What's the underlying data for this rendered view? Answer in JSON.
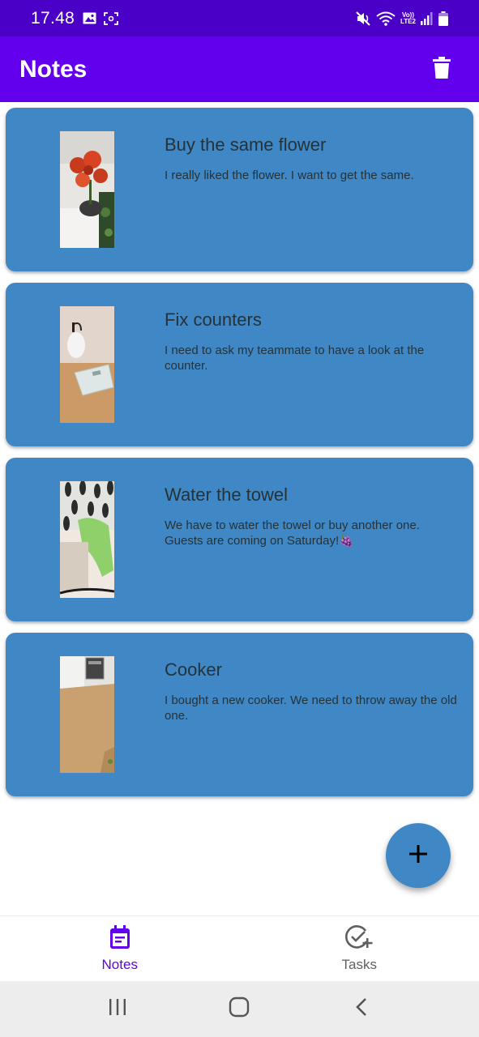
{
  "status_bar": {
    "time": "17.48",
    "network_label": "LTE2"
  },
  "app_bar": {
    "title": "Notes",
    "delete_icon": "trash-icon"
  },
  "notes": [
    {
      "title": "Buy the same flower",
      "body": "I really liked the flower. I want to get the same.",
      "image": "flower-photo"
    },
    {
      "title": "Fix counters",
      "body": "I need to ask my teammate to have a look at the counter.",
      "image": "bathroom-scale-photo"
    },
    {
      "title": "Water the towel",
      "body": "We have to water the towel or buy another one. Guests are coming on Saturday!🍇",
      "image": "towel-photo"
    },
    {
      "title": "Cooker",
      "body": "I bought a new cooker. We need to throw away the old one.",
      "image": "kitchen-floor-photo"
    }
  ],
  "fab": {
    "icon": "plus-icon"
  },
  "bottom_nav": {
    "items": [
      {
        "label": "Notes",
        "icon": "notes-icon",
        "active": true
      },
      {
        "label": "Tasks",
        "icon": "task-add-icon",
        "active": false
      }
    ]
  },
  "colors": {
    "status_bar": "#4a00c6",
    "app_bar": "#6200ee",
    "card": "#3f88c5",
    "active_nav": "#6200ee",
    "card_text": "#263238"
  }
}
